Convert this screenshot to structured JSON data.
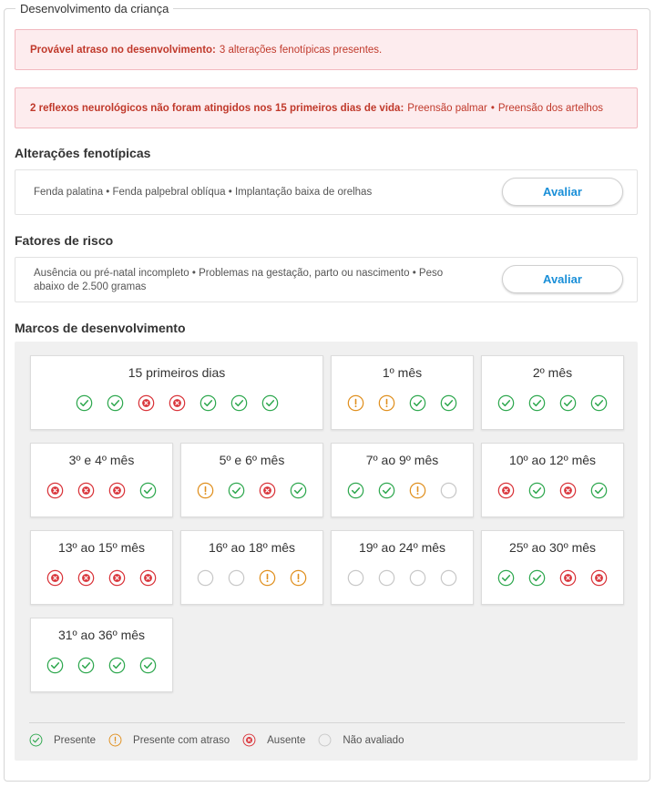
{
  "section": {
    "legend": "Desenvolvimento da criança"
  },
  "alerts": {
    "delay": {
      "bold": "Provável atraso no desenvolvimento:",
      "text": "3 alterações fenotípicas presentes."
    },
    "reflexes": {
      "bold": "2 reflexos neurológicos não foram atingidos nos 15 primeiros dias de vida:",
      "item1": "Preensão palmar",
      "bullet": "•",
      "item2": "Preensão dos artelhos"
    }
  },
  "phenotypic": {
    "title": "Alterações fenotípicas",
    "text": "Fenda palatina • Fenda palpebral oblíqua • Implantação baixa de orelhas",
    "button": "Avaliar"
  },
  "risk": {
    "title": "Fatores de risco",
    "text": "Ausência ou pré-natal incompleto • Problemas na gestação, parto ou nascimento • Peso abaixo de 2.500 gramas",
    "button": "Avaliar"
  },
  "milestones": {
    "title": "Marcos de desenvolvimento",
    "cards": [
      {
        "label": "15 primeiros dias",
        "statuses": [
          "present",
          "present",
          "absent",
          "absent",
          "present",
          "present",
          "present"
        ]
      },
      {
        "label": "1º mês",
        "statuses": [
          "delayed",
          "delayed",
          "present",
          "present"
        ]
      },
      {
        "label": "2º mês",
        "statuses": [
          "present",
          "present",
          "present",
          "present"
        ]
      },
      {
        "label": "3º e 4º mês",
        "statuses": [
          "absent",
          "absent",
          "absent",
          "present"
        ]
      },
      {
        "label": "5º e 6º mês",
        "statuses": [
          "delayed",
          "present",
          "absent",
          "present"
        ]
      },
      {
        "label": "7º ao 9º mês",
        "statuses": [
          "present",
          "present",
          "delayed",
          "not_evaluated"
        ]
      },
      {
        "label": "10º ao 12º mês",
        "statuses": [
          "absent",
          "present",
          "absent",
          "present"
        ]
      },
      {
        "label": "13º ao 15º mês",
        "statuses": [
          "absent",
          "absent",
          "absent",
          "absent"
        ]
      },
      {
        "label": "16º ao 18º mês",
        "statuses": [
          "not_evaluated",
          "not_evaluated",
          "delayed",
          "delayed"
        ]
      },
      {
        "label": "19º ao 24º mês",
        "statuses": [
          "not_evaluated",
          "not_evaluated",
          "not_evaluated",
          "not_evaluated"
        ]
      },
      {
        "label": "25º ao 30º mês",
        "statuses": [
          "present",
          "present",
          "absent",
          "absent"
        ]
      },
      {
        "label": "31º ao 36º mês",
        "statuses": [
          "present",
          "present",
          "present",
          "present"
        ]
      }
    ]
  },
  "legend": {
    "present": "Presente",
    "delayed": "Presente com atraso",
    "absent": "Ausente",
    "not_evaluated": "Não avaliado"
  },
  "colors": {
    "present": "#2fa84f",
    "delayed": "#e0901f",
    "absent": "#d9343a",
    "not_evaluated": "#c8c8c8",
    "link": "#1a8fd8",
    "alert_text": "#c0392b"
  }
}
